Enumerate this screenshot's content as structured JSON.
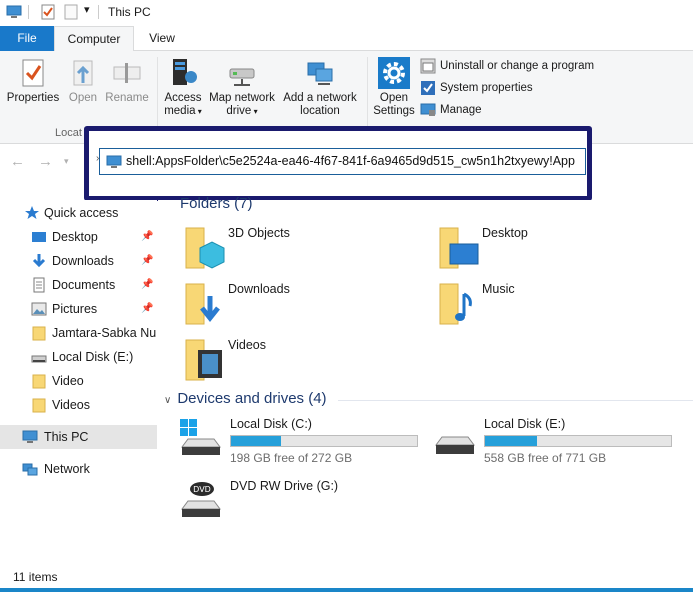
{
  "window": {
    "title": "This PC"
  },
  "tabs": {
    "file": "File",
    "computer": "Computer",
    "view": "View"
  },
  "ribbon": {
    "properties": "Properties",
    "open": "Open",
    "rename": "Rename",
    "access_media_1": "Access",
    "access_media_2": "media",
    "map_drive_1": "Map network",
    "map_drive_2": "drive",
    "add_location_1": "Add a network",
    "add_location_2": "location",
    "open_settings_1": "Open",
    "open_settings_2": "Settings",
    "uninstall": "Uninstall or change a program",
    "system_properties": "System properties",
    "manage": "Manage",
    "group_location": "Locat"
  },
  "address": {
    "value": "shell:AppsFolder\\c5e2524a-ea46-4f67-841f-6a9465d9d515_cw5n1h2txyewy!App"
  },
  "sidebar": {
    "items": [
      {
        "label": "Quick access",
        "icon": "star-icon"
      },
      {
        "label": "Desktop",
        "icon": "desktop-folder-icon",
        "pinned": true
      },
      {
        "label": "Downloads",
        "icon": "download-arrow-icon",
        "pinned": true
      },
      {
        "label": "Documents",
        "icon": "documents-icon",
        "pinned": true
      },
      {
        "label": "Pictures",
        "icon": "pictures-icon",
        "pinned": true
      },
      {
        "label": "Jamtara-Sabka Num",
        "icon": "folder-icon"
      },
      {
        "label": "Local Disk (E:)",
        "icon": "drive-icon"
      },
      {
        "label": "Video",
        "icon": "folder-icon"
      },
      {
        "label": "Videos",
        "icon": "folder-icon"
      },
      {
        "label": "This PC",
        "icon": "computer-icon",
        "selected": true
      },
      {
        "label": "Network",
        "icon": "network-icon"
      }
    ]
  },
  "content": {
    "folders_header": "Folders (7)",
    "folders": [
      {
        "label": "3D Objects"
      },
      {
        "label": "Desktop"
      },
      {
        "label": "Downloads"
      },
      {
        "label": "Music"
      },
      {
        "label": "Videos"
      }
    ],
    "devices_header": "Devices and drives (4)",
    "drives": [
      {
        "name": "Local Disk (C:)",
        "free": "198 GB free of 272 GB",
        "used_fraction": 0.27
      },
      {
        "name": "Local Disk (E:)",
        "free": "558 GB free of 771 GB",
        "used_fraction": 0.28
      },
      {
        "name": "DVD RW Drive (G:)",
        "free": ""
      }
    ]
  },
  "status": {
    "items": "11 items"
  },
  "colors": {
    "accent": "#1979ca",
    "highlight_border": "#1a1a6e",
    "drive_fill": "#26a0da",
    "folder_yellow": "#f8d775"
  }
}
